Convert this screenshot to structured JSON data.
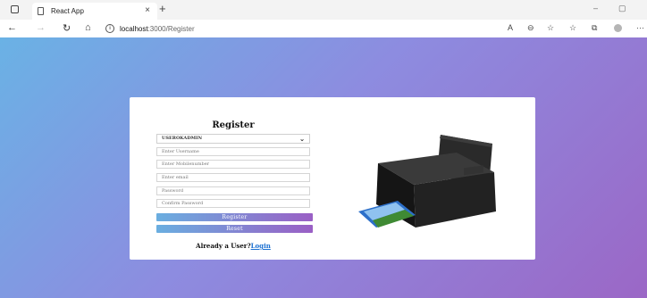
{
  "browser": {
    "tab_title": "React App",
    "tab_close": "×",
    "new_tab": "+",
    "url_host": "localhost",
    "url_path": ":3000/Register",
    "nav_back": "←",
    "nav_forward": "→",
    "nav_refresh": "↻",
    "nav_home": "⌂",
    "win_min": "–",
    "win_max": "▢",
    "read_aloud": "A",
    "zoom": "⊖",
    "favorites": "☆",
    "more": "···"
  },
  "form": {
    "title": "Register",
    "select_value": "USEROKADMIN",
    "username_placeholder": "Enter Username",
    "mobile_placeholder": "Enter Mobilenumber",
    "email_placeholder": "Enter email",
    "password_placeholder": "Password",
    "confirm_placeholder": "Confirm Password",
    "register_label": "Register",
    "reset_label": "Reset",
    "already_text": "Already a User?",
    "login_link": "Login"
  },
  "colors": {
    "gradient_start": "#6ab2e5",
    "gradient_end": "#9b67c6",
    "link": "#1a6fd1"
  },
  "icons": {
    "printer": "printer-image"
  }
}
